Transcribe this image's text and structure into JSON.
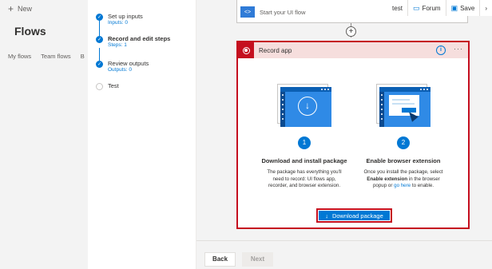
{
  "app": {
    "new_label": "New",
    "page_title": "Flows",
    "tabs": [
      "My flows",
      "Team flows",
      "B"
    ]
  },
  "topbar": {
    "user": "test",
    "forum_label": "Forum",
    "save_label": "Save",
    "chevron": "›"
  },
  "steps": [
    {
      "title": "Set up inputs",
      "sub": "Inputs: 0",
      "state": "done"
    },
    {
      "title": "Record and edit steps",
      "sub": "Steps: 1",
      "state": "active"
    },
    {
      "title": "Review outputs",
      "sub": "Outputs: 0",
      "state": "done"
    },
    {
      "title": "Test",
      "sub": "",
      "state": "pending"
    }
  ],
  "canvas": {
    "prev_card_label": "Start your UI flow",
    "add_step_symbol": "+",
    "record_card": {
      "title": "Record app",
      "info_symbol": "i",
      "more_symbol": "···",
      "col1": {
        "number": "1",
        "title": "Download and install package",
        "desc": "The package has everything you'll need to record: UI flows app, recorder, and browser extension."
      },
      "col2": {
        "number": "2",
        "title": "Enable browser extension",
        "desc_a": "Once you install the package, select",
        "desc_bold": "Enable extension",
        "desc_b": "in the browser popup or",
        "desc_link": "go here",
        "desc_c": "to enable."
      },
      "download_label": "Download package",
      "download_symbol": "↓"
    }
  },
  "footer": {
    "back_label": "Back",
    "next_label": "Next"
  },
  "colors": {
    "accent": "#0078d4",
    "record_red": "#c50f1f"
  }
}
